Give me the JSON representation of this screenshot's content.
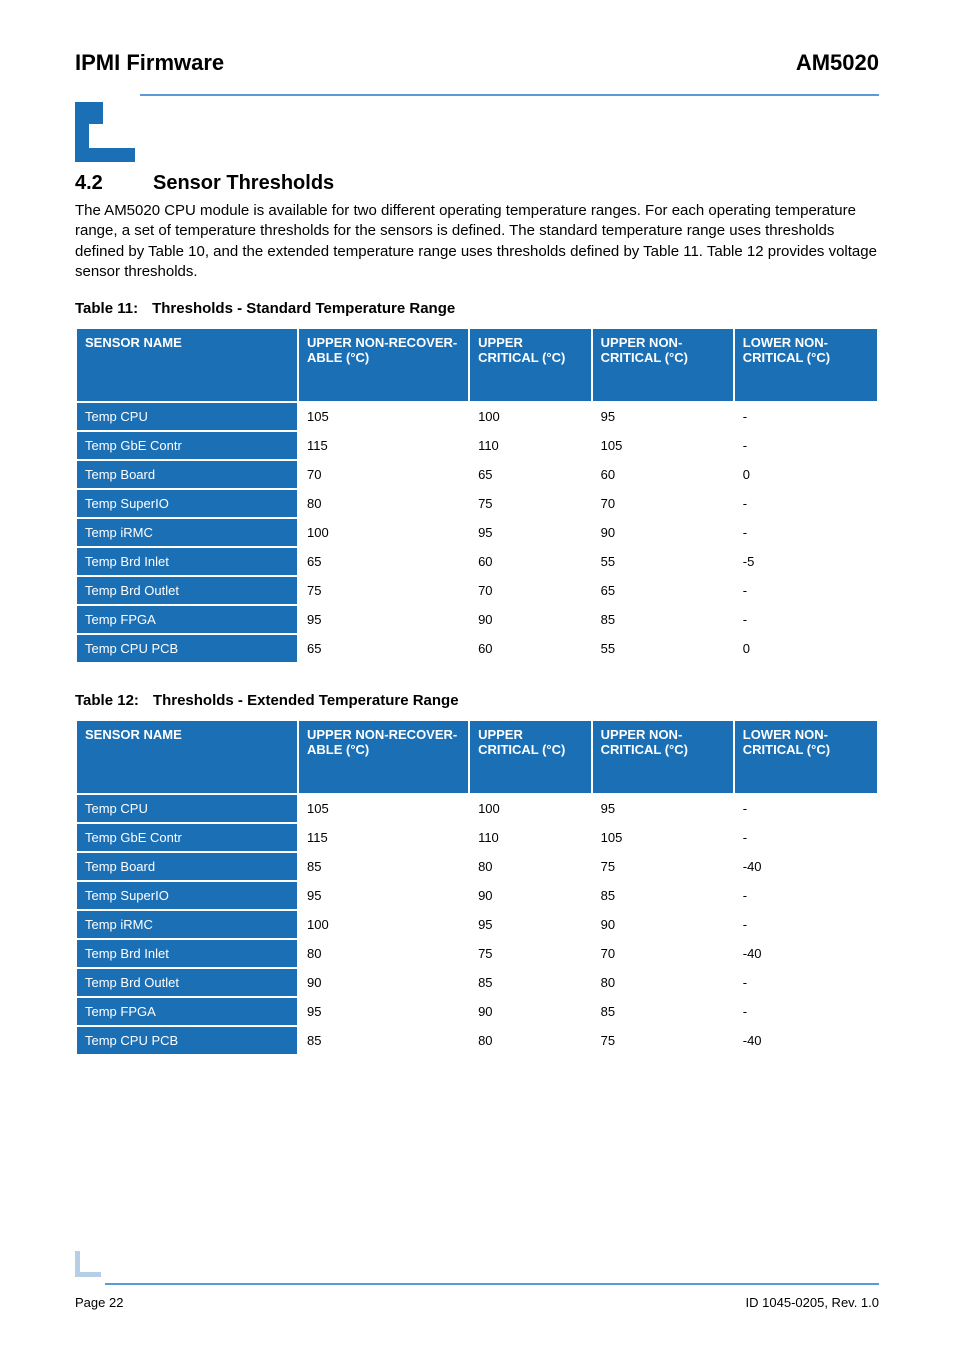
{
  "header": {
    "left": "IPMI Firmware",
    "right": "AM5020"
  },
  "section": {
    "number": "4.2",
    "title": "Sensor Thresholds"
  },
  "paragraph": "The AM5020 CPU module is available for two different operating temperature ranges. For each operating temperature range, a set of temperature thresholds for the sensors is defined. The standard temperature range uses thresholds defined by Table 10, and the extended temperature range uses thresholds defined by Table 11. Table 12 provides voltage sensor thresholds.",
  "table11": {
    "caption_label": "Table 11:",
    "caption_text": "Thresholds - Standard Temperature Range",
    "headers": [
      "SENSOR NAME",
      "UPPER NON-RECOVER-ABLE (°C)",
      "UPPER CRITICAL (°C)",
      "UPPER NON-CRITICAL (°C)",
      "LOWER NON-CRITICAL (°C)"
    ],
    "rows": [
      [
        "Temp CPU",
        "105",
        "100",
        "95",
        "-"
      ],
      [
        "Temp GbE Contr",
        "115",
        "110",
        "105",
        "-"
      ],
      [
        "Temp Board",
        "70",
        "65",
        "60",
        "0"
      ],
      [
        "Temp SuperIO",
        "80",
        "75",
        "70",
        "-"
      ],
      [
        "Temp iRMC",
        "100",
        "95",
        "90",
        "-"
      ],
      [
        "Temp Brd Inlet",
        "65",
        "60",
        "55",
        "-5"
      ],
      [
        "Temp Brd Outlet",
        "75",
        "70",
        "65",
        "-"
      ],
      [
        "Temp FPGA",
        "95",
        "90",
        "85",
        "-"
      ],
      [
        "Temp CPU PCB",
        "65",
        "60",
        "55",
        "0"
      ]
    ]
  },
  "table12": {
    "caption_label": "Table 12:",
    "caption_text": "Thresholds - Extended Temperature Range",
    "headers": [
      "SENSOR NAME",
      "UPPER NON-RECOVER-ABLE (°C)",
      "UPPER CRITICAL (°C)",
      "UPPER NON-CRITICAL (°C)",
      "LOWER NON-CRITICAL (°C)"
    ],
    "rows": [
      [
        "Temp CPU",
        "105",
        "100",
        "95",
        "-"
      ],
      [
        "Temp GbE Contr",
        "115",
        "110",
        "105",
        "-"
      ],
      [
        "Temp Board",
        "85",
        "80",
        "75",
        "-40"
      ],
      [
        "Temp SuperIO",
        "95",
        "90",
        "85",
        "-"
      ],
      [
        "Temp iRMC",
        "100",
        "95",
        "90",
        "-"
      ],
      [
        "Temp Brd Inlet",
        "80",
        "75",
        "70",
        "-40"
      ],
      [
        "Temp Brd Outlet",
        "90",
        "85",
        "80",
        "-"
      ],
      [
        "Temp FPGA",
        "95",
        "90",
        "85",
        "-"
      ],
      [
        "Temp CPU PCB",
        "85",
        "80",
        "75",
        "-40"
      ]
    ]
  },
  "footer": {
    "left": "Page 22",
    "right": "ID 1045-0205, Rev. 1.0"
  }
}
